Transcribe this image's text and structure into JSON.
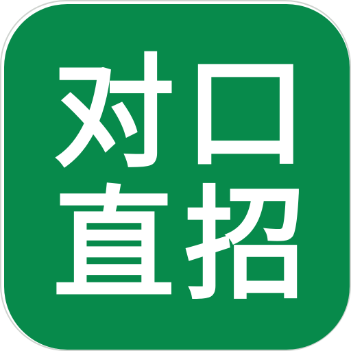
{
  "app_icon": {
    "background_color": "#078a4b",
    "text_color": "#ffffff",
    "characters": [
      "对",
      "口",
      "直",
      "招"
    ]
  }
}
